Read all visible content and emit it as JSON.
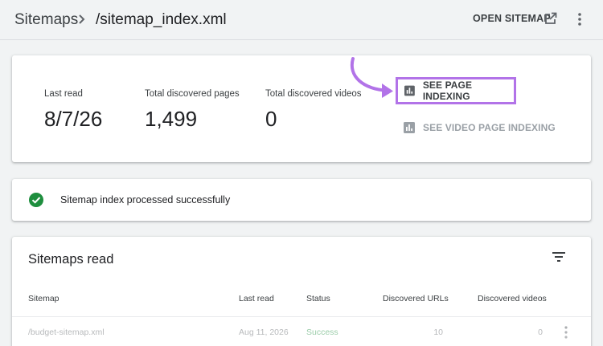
{
  "header": {
    "breadcrumb_root": "Sitemaps",
    "breadcrumb_current": "/sitemap_index.xml",
    "open_sitemap_label": "OPEN SITEMAP"
  },
  "stats": {
    "last_read_label": "Last read",
    "last_read_value": "8/7/26",
    "pages_label": "Total discovered pages",
    "pages_value": "1,499",
    "videos_label": "Total discovered videos",
    "videos_value": "0"
  },
  "actions": {
    "page_indexing_label": "SEE PAGE INDEXING",
    "video_indexing_label": "SEE VIDEO PAGE INDEXING"
  },
  "status": {
    "message": "Sitemap index processed successfully"
  },
  "table": {
    "title": "Sitemaps read",
    "columns": [
      "Sitemap",
      "Last read",
      "Status",
      "Discovered URLs",
      "Discovered videos"
    ],
    "rows": [
      [
        "/budget-sitemap.xml",
        "Aug 11, 2026",
        "Success",
        "10",
        "0"
      ]
    ]
  },
  "colors": {
    "highlight": "#b273e8",
    "success": "#1e8e3e",
    "background": "#f1f3f4"
  },
  "icons": [
    "chevron-right-icon",
    "open-in-new-icon",
    "more-vert-icon",
    "bar-chart-icon",
    "check-circle-icon",
    "filter-icon"
  ]
}
